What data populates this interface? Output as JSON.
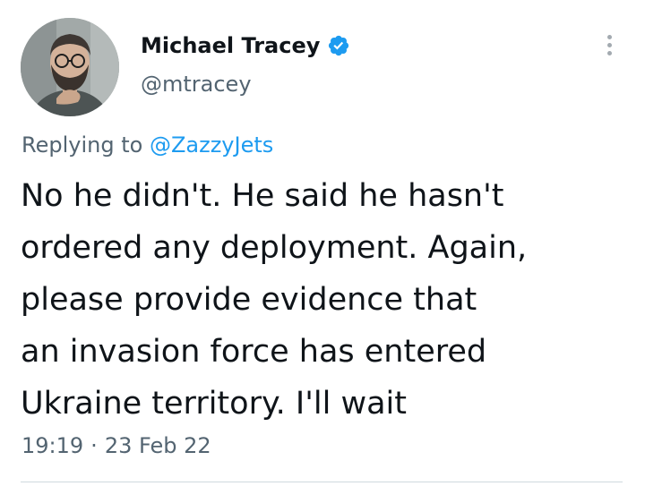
{
  "author": {
    "name": "Michael Tracey",
    "handle": "@mtracey",
    "verified": true,
    "avatar_icon": "profile-photo-bearded-man-with-glasses"
  },
  "reply_context": {
    "prefix": "Replying to",
    "handle": "@ZazzyJets"
  },
  "tweet": {
    "text_lines": [
      "No he didn't. He said he hasn't",
      "ordered any deployment. Again,",
      "please provide evidence that",
      "an invasion force has entered",
      "Ukraine territory. I'll wait"
    ],
    "time": "19:19",
    "date": "23 Feb 22"
  },
  "menu": {
    "icon": "more-vertical-icon"
  },
  "colors": {
    "text_primary": "#0f1419",
    "text_secondary": "#536471",
    "link": "#1d9bf0",
    "verified": "#1d9bf0",
    "divider": "#cfd9de"
  }
}
